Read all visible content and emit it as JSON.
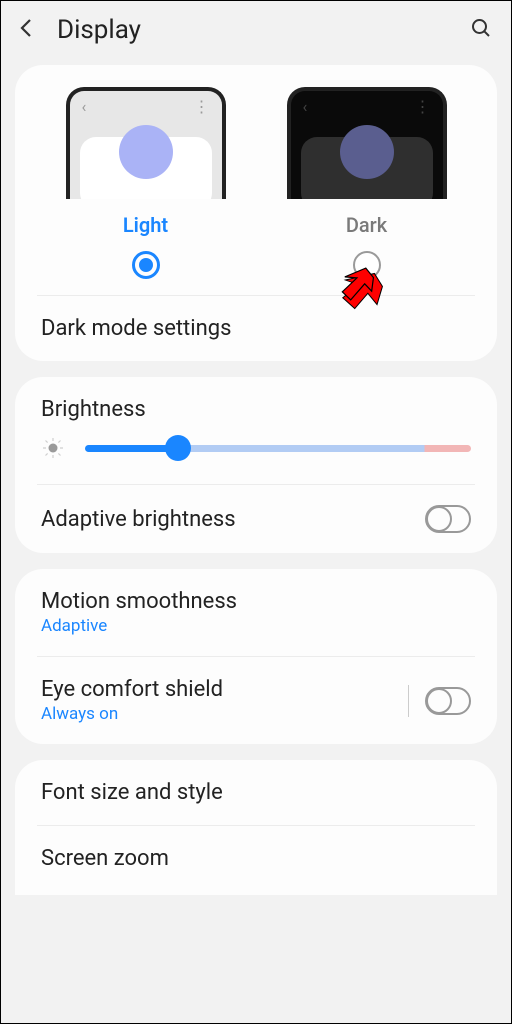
{
  "header": {
    "title": "Display"
  },
  "theme": {
    "light_label": "Light",
    "dark_label": "Dark",
    "selected": "light"
  },
  "dark_mode_settings_label": "Dark mode settings",
  "brightness": {
    "title": "Brightness",
    "value_pct": 24
  },
  "adaptive_brightness": {
    "label": "Adaptive brightness",
    "enabled": false
  },
  "motion_smoothness": {
    "label": "Motion smoothness",
    "value": "Adaptive"
  },
  "eye_comfort": {
    "label": "Eye comfort shield",
    "value": "Always on",
    "enabled": false
  },
  "font_label": "Font size and style",
  "zoom_label": "Screen zoom"
}
